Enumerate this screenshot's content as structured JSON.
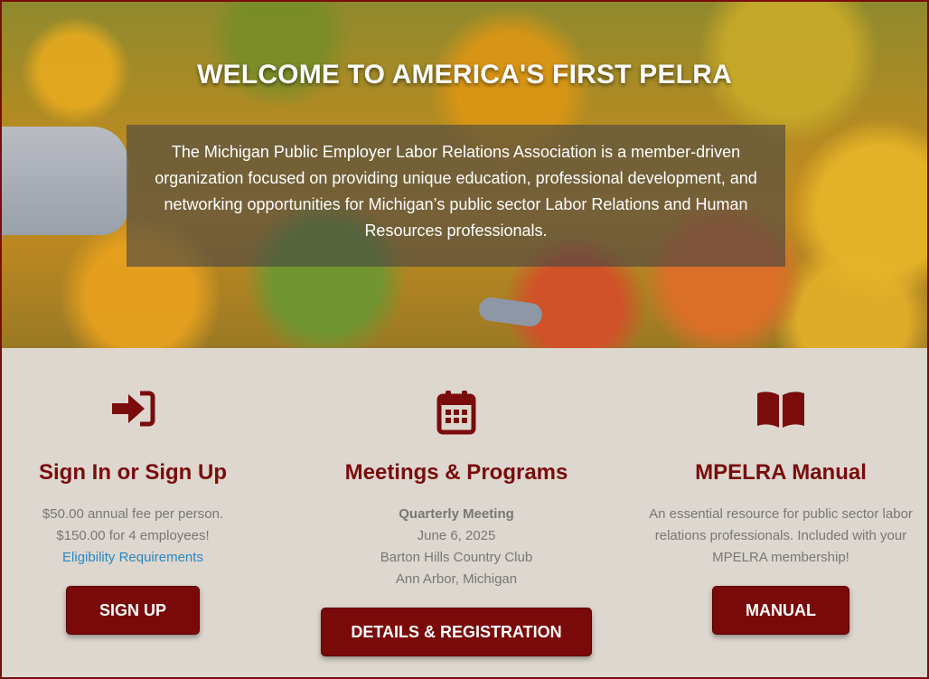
{
  "hero": {
    "title": "WELCOME TO AMERICA'S FIRST PELRA",
    "description": "The Michigan Public Employer Labor Relations Association is a member-driven organization focused on providing unique education, professional development, and networking opportunities for Michigan’s public sector Labor Relations and Human Resources professionals."
  },
  "features": {
    "signup": {
      "icon": "sign-in-icon",
      "title": "Sign In or Sign Up",
      "fee_line1": "$50.00 annual fee per person.",
      "fee_line2": "$150.00 for 4 employees!",
      "link": "Eligibility Requirements",
      "button": "SIGN UP"
    },
    "meetings": {
      "icon": "calendar-icon",
      "title": "Meetings & Programs",
      "event_name": "Quarterly Meeting",
      "date": "June 6, 2025",
      "venue": "Barton Hills Country Club",
      "location": "Ann Arbor, Michigan",
      "button": "DETAILS & REGISTRATION"
    },
    "manual": {
      "icon": "book-icon",
      "title": "MPELRA Manual",
      "description": "An essential resource for public sector labor relations professionals. Included with your MPELRA membership!",
      "button": "MANUAL"
    }
  },
  "colors": {
    "accent": "#7a0c0c",
    "link": "#2a86c4",
    "panel_bg": "#ddd7cf"
  }
}
